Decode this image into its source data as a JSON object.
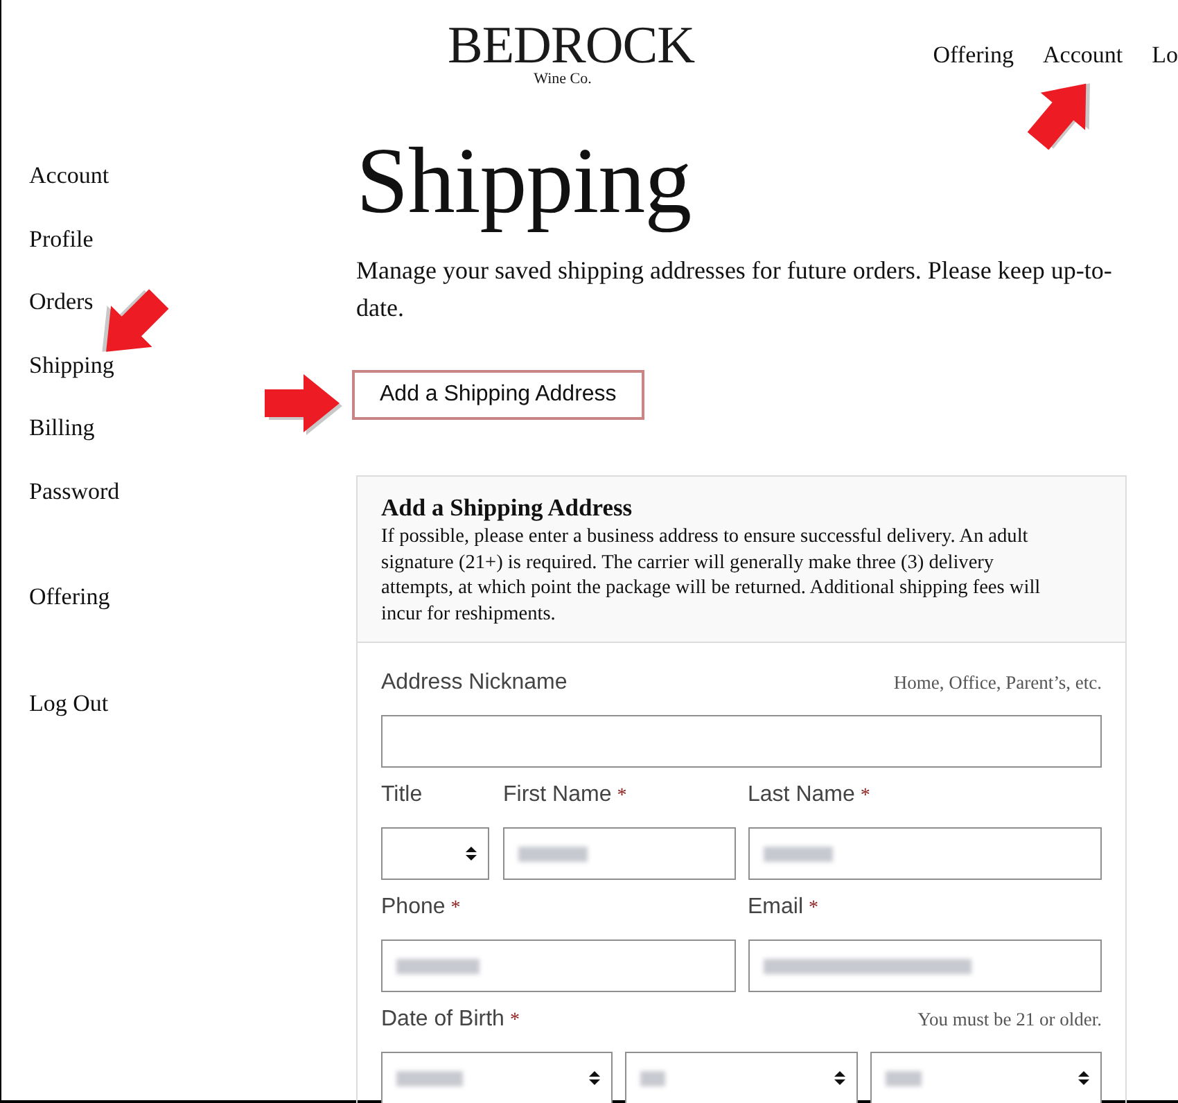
{
  "logo": {
    "wordmark": "BEDROCK",
    "tagline": "Wine Co."
  },
  "top_nav": [
    "Offering",
    "Account",
    "Lo"
  ],
  "sidebar": {
    "groups": [
      [
        "Account",
        "Profile",
        "Orders",
        "Shipping",
        "Billing",
        "Password"
      ],
      [
        "Offering"
      ],
      [
        "Log Out"
      ]
    ]
  },
  "page": {
    "title": "Shipping",
    "description": "Manage your saved shipping addresses for future orders. Please keep up-to-date."
  },
  "add_button": "Add a Shipping Address",
  "form": {
    "title": "Add a Shipping Address",
    "note": "If possible, please enter a business address to ensure successful delivery. An adult signature (21+) is required. The carrier will generally make three (3) delivery attempts, at which point the package will be returned. Additional shipping fees will incur for reshipments.",
    "required_mark": "*",
    "rows": [
      {
        "fields": [
          {
            "kind": "text",
            "label": "Address Nickname",
            "required": false,
            "hint": "Home, Office, Parent’s, etc.",
            "redacted": false
          }
        ]
      },
      {
        "fields": [
          {
            "kind": "select",
            "label": "Title",
            "required": false,
            "redacted": false
          },
          {
            "kind": "text",
            "label": "First Name",
            "required": true,
            "redacted": true
          },
          {
            "kind": "text",
            "label": "Last Name",
            "required": true,
            "redacted": true
          }
        ]
      },
      {
        "fields": [
          {
            "kind": "text",
            "label": "Phone",
            "required": true,
            "redacted": true
          },
          {
            "kind": "text",
            "label": "Email",
            "required": true,
            "redacted": true
          }
        ]
      },
      {
        "fields": [
          {
            "kind": "date",
            "label": "Date of Birth",
            "required": true,
            "hint": "You must be 21 or older.",
            "parts": [
              {
                "redacted": true
              },
              {
                "redacted": true
              },
              {
                "redacted": true
              }
            ]
          }
        ]
      }
    ]
  }
}
